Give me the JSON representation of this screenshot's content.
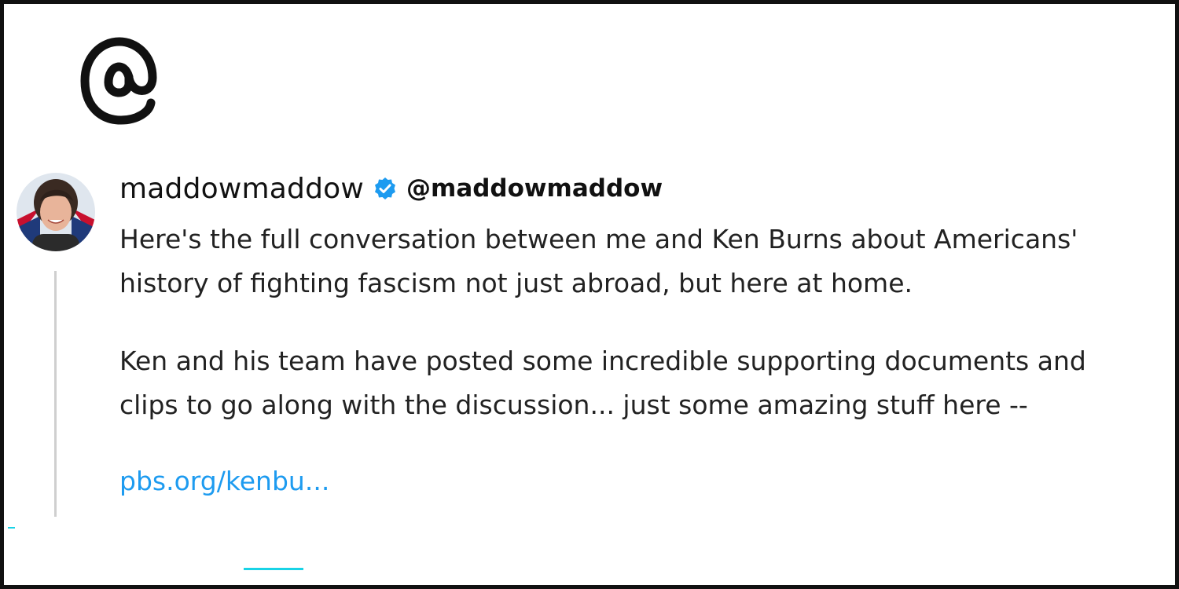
{
  "app": {
    "logo_icon": "threads-logo-icon"
  },
  "post": {
    "avatar_icon": "user-avatar",
    "display_name": "maddowmaddow",
    "verified_icon": "verified-badge-icon",
    "handle": "@maddowmaddow",
    "paragraph_1": "Here's the full conversation between me and Ken Burns about Americans'\nhistory of fighting fascism not just abroad, but here at home.",
    "paragraph_2": "Ken and his team have posted some incredible supporting documents and\nclips to go along with the discussion... just some amazing stuff here --",
    "link_text": "pbs.org/kenbu..."
  },
  "colors": {
    "link": "#1d9bf0",
    "verified": "#1d9bf0",
    "thread_line": "#cfcfcf",
    "accent_marks": "#19d3e6"
  }
}
